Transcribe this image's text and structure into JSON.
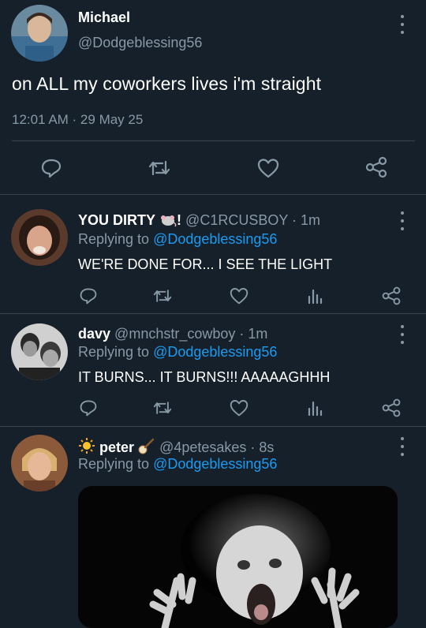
{
  "colors": {
    "background": "#15202b",
    "text": "#ffffff",
    "muted": "#8899a6",
    "link": "#1d9bf0",
    "divider": "#38444d"
  },
  "main_tweet": {
    "name": "Michael",
    "handle": "@Dodgeblessing56",
    "text": "on ALL my coworkers lives i'm straight",
    "timestamp": "12:01 AM · 29 May 25",
    "actions": [
      "reply-icon",
      "retweet-icon",
      "like-icon",
      "share-icon"
    ]
  },
  "replies": [
    {
      "name": "YOU DIRTY",
      "name_suffix": "!",
      "emoji": "rat-emoji",
      "handle": "@C1RCUSBOY · 1m",
      "replying_prefix": "Replying to ",
      "replying_to": "@Dodgeblessing56",
      "text": "WE'RE DONE FOR... I SEE THE LIGHT"
    },
    {
      "name": "davy",
      "handle": "@mnchstr_cowboy · 1m",
      "replying_prefix": "Replying to ",
      "replying_to": "@Dodgeblessing56",
      "text": "IT BURNS... IT BURNS!!! AAAAAGHHH"
    },
    {
      "name": "peter",
      "emoji_before": "sun-emoji",
      "emoji_after": "banjo-emoji",
      "handle": "@4petesakes · 8s",
      "replying_prefix": "Replying to ",
      "replying_to": "@Dodgeblessing56",
      "media": "screaming-figure-photo"
    }
  ]
}
